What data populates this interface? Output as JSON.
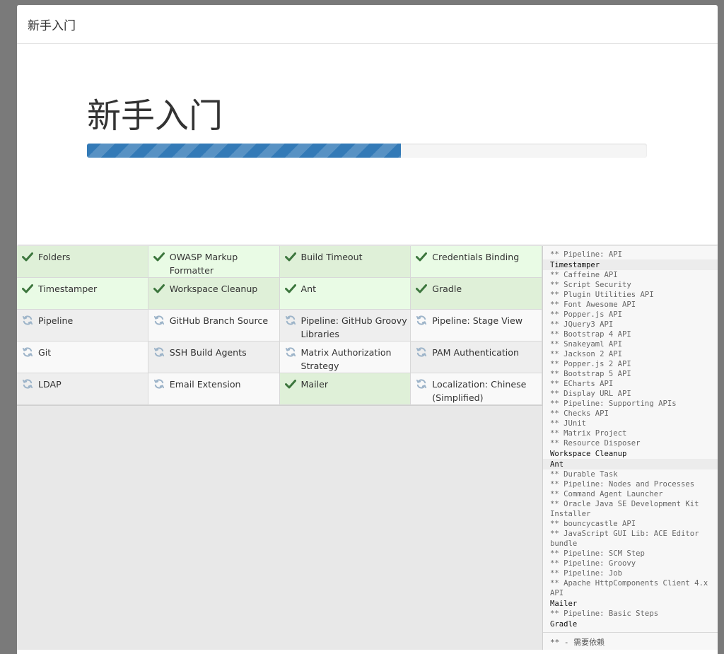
{
  "header": {
    "title": "新手入门"
  },
  "hero": {
    "title": "新手入门",
    "progress": 0.56
  },
  "colors": {
    "success": "#3c763d",
    "pending": "#9db4c9",
    "progress": "#337ab7"
  },
  "plugins": [
    {
      "name": "Folders",
      "status": "success"
    },
    {
      "name": "OWASP Markup Formatter",
      "status": "success"
    },
    {
      "name": "Build Timeout",
      "status": "success"
    },
    {
      "name": "Credentials Binding",
      "status": "success"
    },
    {
      "name": "Timestamper",
      "status": "success"
    },
    {
      "name": "Workspace Cleanup",
      "status": "success"
    },
    {
      "name": "Ant",
      "status": "success"
    },
    {
      "name": "Gradle",
      "status": "success"
    },
    {
      "name": "Pipeline",
      "status": "pending"
    },
    {
      "name": "GitHub Branch Source",
      "status": "pending"
    },
    {
      "name": "Pipeline: GitHub Groovy Libraries",
      "status": "pending"
    },
    {
      "name": "Pipeline: Stage View",
      "status": "pending"
    },
    {
      "name": "Git",
      "status": "pending"
    },
    {
      "name": "SSH Build Agents",
      "status": "pending"
    },
    {
      "name": "Matrix Authorization Strategy",
      "status": "pending"
    },
    {
      "name": "PAM Authentication",
      "status": "pending"
    },
    {
      "name": "LDAP",
      "status": "pending"
    },
    {
      "name": "Email Extension",
      "status": "pending"
    },
    {
      "name": "Mailer",
      "status": "success"
    },
    {
      "name": "Localization: Chinese (Simplified)",
      "status": "pending"
    }
  ],
  "log": {
    "lines": [
      {
        "text": "** Pipeline: API",
        "type": "dep"
      },
      {
        "text": "Timestamper",
        "type": "plugin",
        "highlight": true
      },
      {
        "text": "** Caffeine API",
        "type": "dep"
      },
      {
        "text": "** Script Security",
        "type": "dep"
      },
      {
        "text": "** Plugin Utilities API",
        "type": "dep"
      },
      {
        "text": "** Font Awesome API",
        "type": "dep"
      },
      {
        "text": "** Popper.js API",
        "type": "dep"
      },
      {
        "text": "** JQuery3 API",
        "type": "dep"
      },
      {
        "text": "** Bootstrap 4 API",
        "type": "dep"
      },
      {
        "text": "** Snakeyaml API",
        "type": "dep"
      },
      {
        "text": "** Jackson 2 API",
        "type": "dep"
      },
      {
        "text": "** Popper.js 2 API",
        "type": "dep"
      },
      {
        "text": "** Bootstrap 5 API",
        "type": "dep"
      },
      {
        "text": "** ECharts API",
        "type": "dep"
      },
      {
        "text": "** Display URL API",
        "type": "dep"
      },
      {
        "text": "** Pipeline: Supporting APIs",
        "type": "dep"
      },
      {
        "text": "** Checks API",
        "type": "dep"
      },
      {
        "text": "** JUnit",
        "type": "dep"
      },
      {
        "text": "** Matrix Project",
        "type": "dep"
      },
      {
        "text": "** Resource Disposer",
        "type": "dep"
      },
      {
        "text": "Workspace Cleanup",
        "type": "plugin",
        "highlight": false
      },
      {
        "text": "Ant",
        "type": "plugin",
        "highlight": true
      },
      {
        "text": "** Durable Task",
        "type": "dep"
      },
      {
        "text": "** Pipeline: Nodes and Processes",
        "type": "dep"
      },
      {
        "text": "** Command Agent Launcher",
        "type": "dep"
      },
      {
        "text": "** Oracle Java SE Development Kit Installer",
        "type": "dep"
      },
      {
        "text": "** bouncycastle API",
        "type": "dep"
      },
      {
        "text": "** JavaScript GUI Lib: ACE Editor bundle",
        "type": "dep"
      },
      {
        "text": "** Pipeline: SCM Step",
        "type": "dep"
      },
      {
        "text": "** Pipeline: Groovy",
        "type": "dep"
      },
      {
        "text": "** Pipeline: Job",
        "type": "dep"
      },
      {
        "text": "** Apache HttpComponents Client 4.x API",
        "type": "dep"
      },
      {
        "text": "Mailer",
        "type": "plugin",
        "highlight": false
      },
      {
        "text": "** Pipeline: Basic Steps",
        "type": "dep"
      },
      {
        "text": "Gradle",
        "type": "plugin",
        "highlight": false
      }
    ],
    "footer": "** - 需要依赖"
  }
}
